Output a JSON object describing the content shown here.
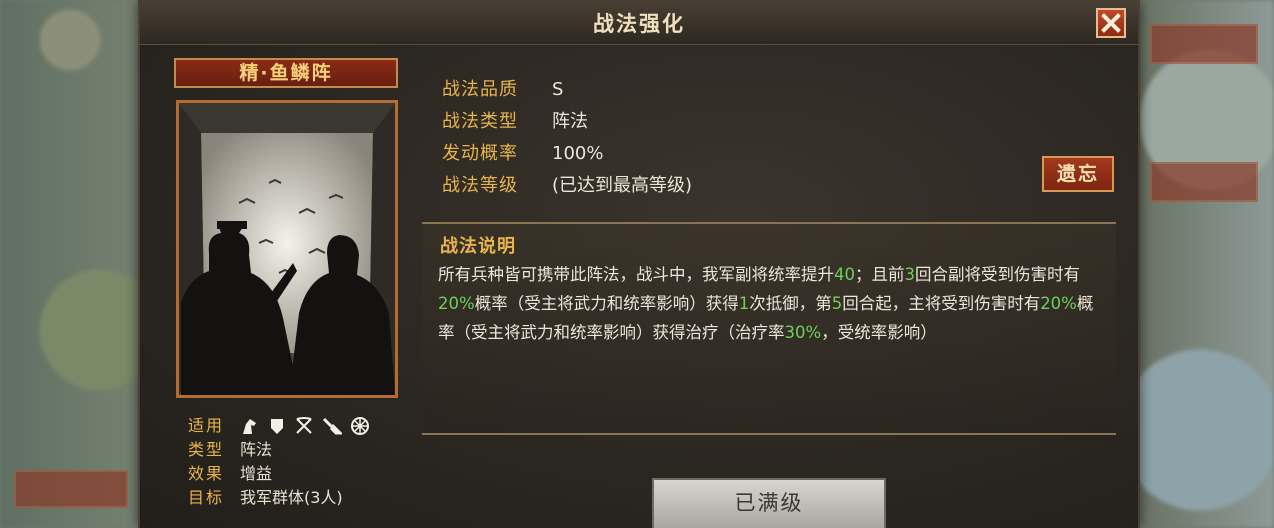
{
  "window": {
    "title": "战法强化"
  },
  "skill": {
    "name": "精·鱼鳞阵"
  },
  "attributes": [
    {
      "label": "战法品质",
      "value": "S"
    },
    {
      "label": "战法类型",
      "value": "阵法"
    },
    {
      "label": "发动概率",
      "value": "100%"
    },
    {
      "label": "战法等级",
      "value": "(已达到最高等级)"
    }
  ],
  "forget_button": "遗忘",
  "description": {
    "title": "战法说明",
    "segments": [
      {
        "text": "所有兵种皆可携带此阵法，战斗中，我军副将统率提升",
        "hl": false
      },
      {
        "text": "40",
        "hl": true
      },
      {
        "text": "；且前",
        "hl": false
      },
      {
        "text": "3",
        "hl": true
      },
      {
        "text": "回合副将受到伤害时有",
        "hl": false
      },
      {
        "text": "20%",
        "hl": true
      },
      {
        "text": "概率（受主将武力和统率影响）获得",
        "hl": false
      },
      {
        "text": "1",
        "hl": true
      },
      {
        "text": "次抵御，第",
        "hl": false
      },
      {
        "text": "5",
        "hl": true
      },
      {
        "text": "回合起，主将受到伤害时有",
        "hl": false
      },
      {
        "text": "20%",
        "hl": true
      },
      {
        "text": "概率（受主将武力和统率影响）获得治疗（治疗率",
        "hl": false
      },
      {
        "text": "30%",
        "hl": true
      },
      {
        "text": "，受统率影响）",
        "hl": false
      }
    ]
  },
  "meta": {
    "applicable_label": "适用",
    "applicable_icons": [
      "cavalry-icon",
      "shield-icon",
      "bow-icon",
      "spear-icon",
      "siege-icon"
    ],
    "type_label": "类型",
    "type_value": "阵法",
    "effect_label": "效果",
    "effect_value": "增益",
    "target_label": "目标",
    "target_value": "我军群体(3人)"
  },
  "maxed_button": "已满级",
  "colors": {
    "label_gold": "#e8b44c",
    "highlight_green": "#6dd05b",
    "name_plate_red": "#8a2b16"
  }
}
